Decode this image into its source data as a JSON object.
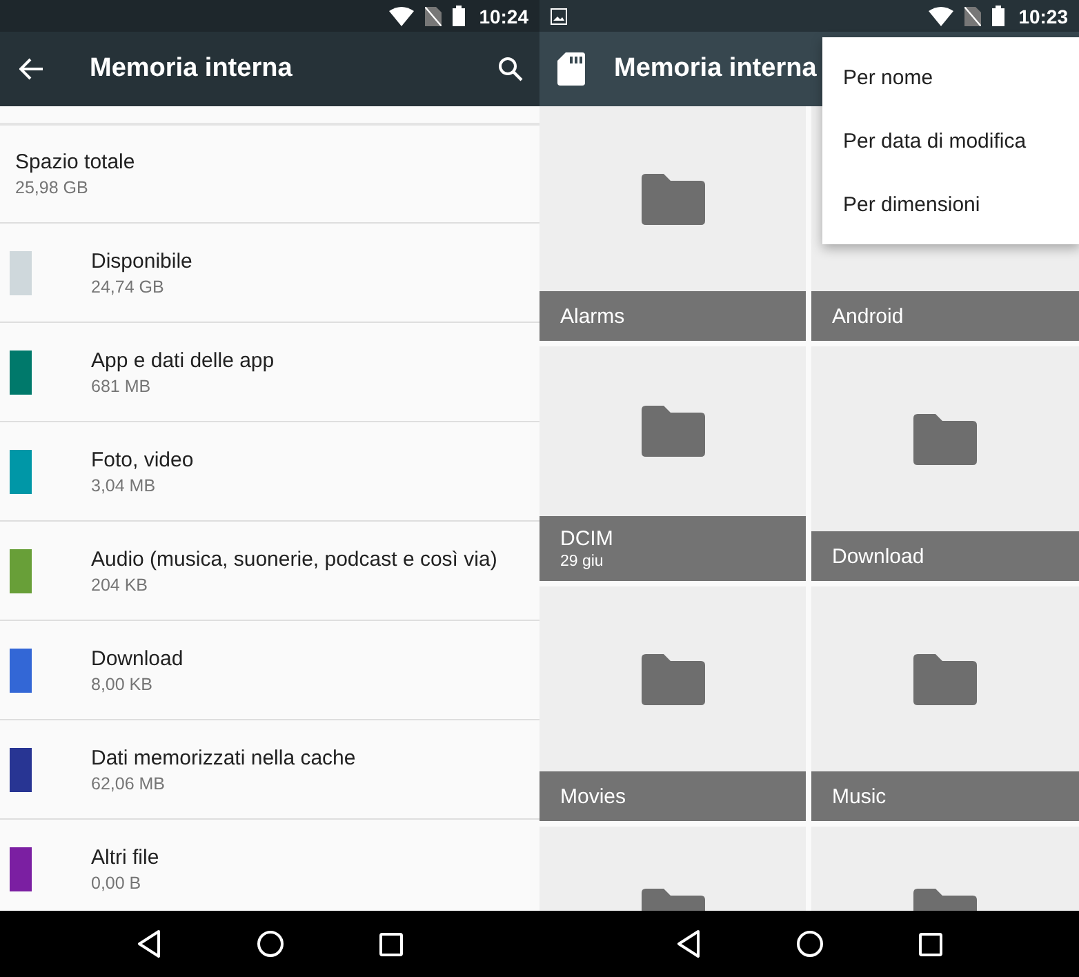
{
  "left_screen": {
    "status_bar": {
      "time": "10:24"
    },
    "toolbar": {
      "title": "Memoria interna"
    },
    "total": {
      "label": "Spazio totale",
      "value": "25,98 GB"
    },
    "categories": [
      {
        "label": "Disponibile",
        "value": "24,74 GB",
        "color": "#cfd8dc"
      },
      {
        "label": "App e dati delle app",
        "value": "681 MB",
        "color": "#00796b"
      },
      {
        "label": "Foto, video",
        "value": "3,04 MB",
        "color": "#0097a7"
      },
      {
        "label": "Audio (musica, suonerie, podcast e così via)",
        "value": "204 KB",
        "color": "#689f38"
      },
      {
        "label": "Download",
        "value": "8,00 KB",
        "color": "#3367d6"
      },
      {
        "label": "Dati memorizzati nella cache",
        "value": "62,06 MB",
        "color": "#283593"
      },
      {
        "label": "Altri file",
        "value": "0,00 B",
        "color": "#7b1fa2"
      }
    ]
  },
  "right_screen": {
    "status_bar": {
      "time": "10:23"
    },
    "toolbar": {
      "title": "Memoria interna"
    },
    "folders": [
      {
        "kind": "folder",
        "name": "Alarms",
        "icon_shown": true
      },
      {
        "kind": "folder",
        "name": "Android",
        "icon_shown": false
      },
      {
        "kind": "folder",
        "name": "DCIM",
        "date": "29 giu",
        "icon_shown": true
      },
      {
        "kind": "folder",
        "name": "Download",
        "icon_shown": true
      },
      {
        "kind": "folder",
        "name": "Movies",
        "icon_shown": true
      },
      {
        "kind": "folder",
        "name": "Music",
        "icon_shown": true
      },
      {
        "kind": "folder",
        "icon_shown": true
      },
      {
        "kind": "folder",
        "icon_shown": true
      }
    ],
    "sort_menu": [
      {
        "label": "Per nome"
      },
      {
        "label": "Per data di modifica"
      },
      {
        "label": "Per dimensioni"
      }
    ]
  }
}
